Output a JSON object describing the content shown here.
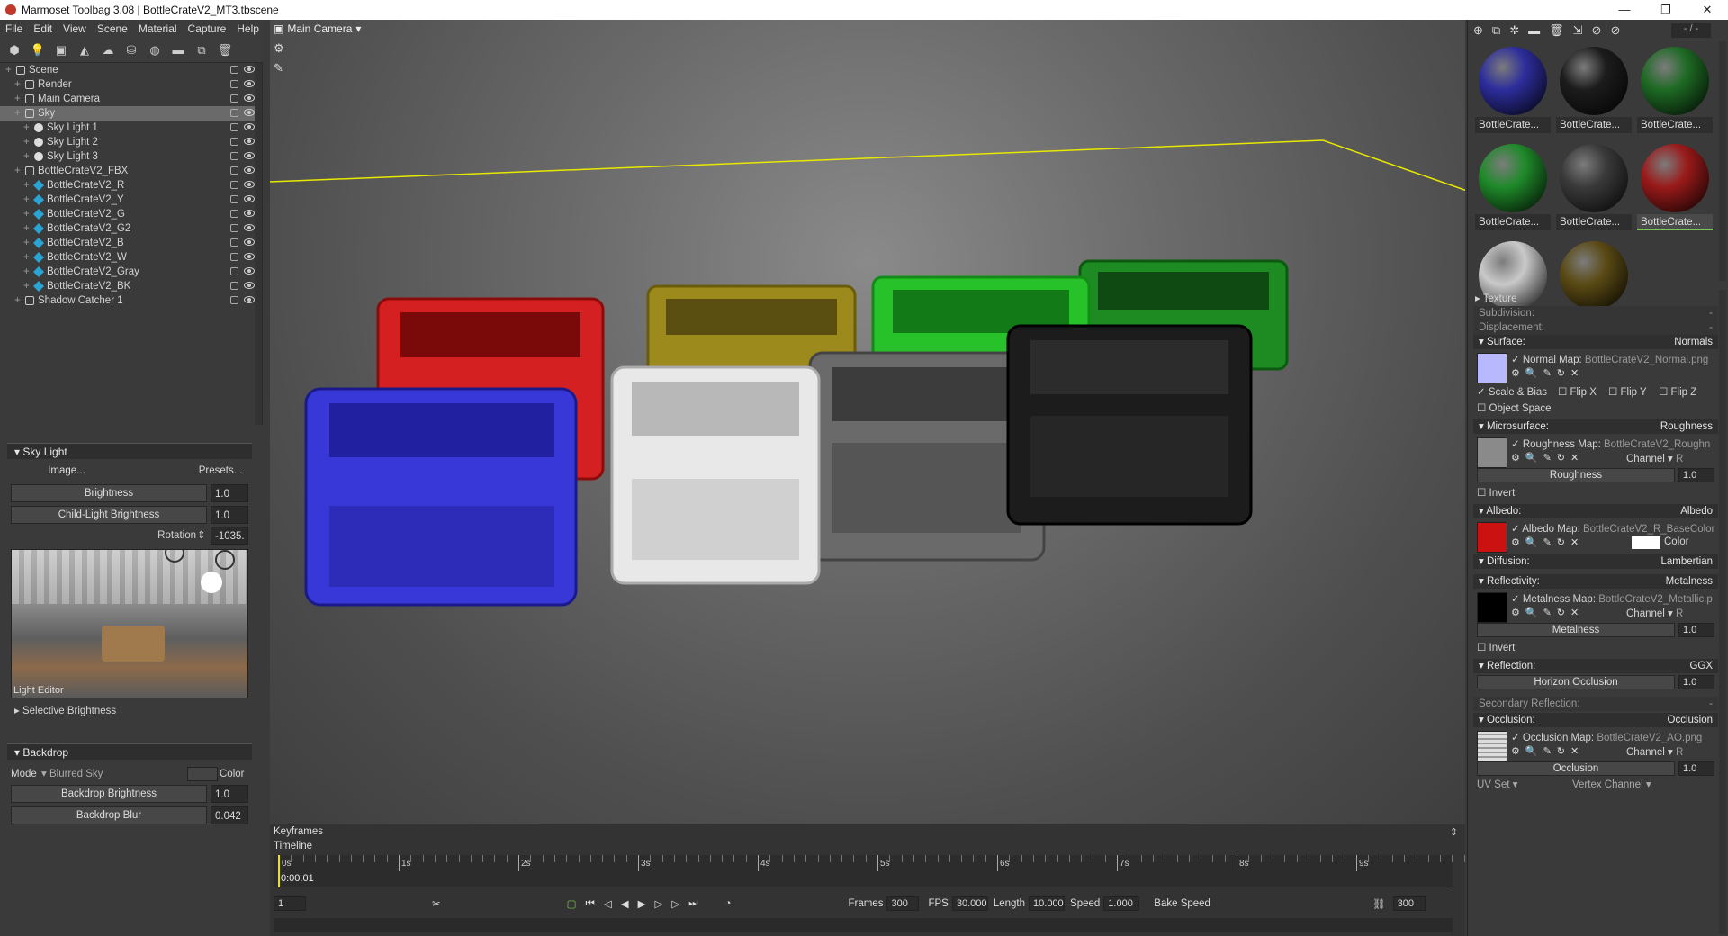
{
  "window": {
    "title": "Marmoset Toolbag 3.08  |  BottleCrateV2_MT3.tbscene",
    "minimize": "—",
    "restore": "❐",
    "close": "✕"
  },
  "menu": [
    "File",
    "Edit",
    "View",
    "Scene",
    "Material",
    "Capture",
    "Help"
  ],
  "viewport": {
    "camera_label": "Main Camera"
  },
  "outliner": {
    "items": [
      {
        "label": "Scene",
        "depth": 0,
        "icon": "scene-icon"
      },
      {
        "label": "Render",
        "depth": 1,
        "icon": "render-icon"
      },
      {
        "label": "Main Camera",
        "depth": 1,
        "icon": "camera-icon"
      },
      {
        "label": "Sky",
        "depth": 1,
        "icon": "sky-icon",
        "selected": true
      },
      {
        "label": "Sky Light 1",
        "depth": 2,
        "icon": "light-icon"
      },
      {
        "label": "Sky Light 2",
        "depth": 2,
        "icon": "light-icon"
      },
      {
        "label": "Sky Light 3",
        "depth": 2,
        "icon": "light-icon"
      },
      {
        "label": "BottleCrateV2_FBX",
        "depth": 1,
        "icon": "mesh-group-icon"
      },
      {
        "label": "BottleCrateV2_R",
        "depth": 2,
        "icon": "mesh-icon"
      },
      {
        "label": "BottleCrateV2_Y",
        "depth": 2,
        "icon": "mesh-icon"
      },
      {
        "label": "BottleCrateV2_G",
        "depth": 2,
        "icon": "mesh-icon"
      },
      {
        "label": "BottleCrateV2_G2",
        "depth": 2,
        "icon": "mesh-icon"
      },
      {
        "label": "BottleCrateV2_B",
        "depth": 2,
        "icon": "mesh-icon"
      },
      {
        "label": "BottleCrateV2_W",
        "depth": 2,
        "icon": "mesh-icon"
      },
      {
        "label": "BottleCrateV2_Gray",
        "depth": 2,
        "icon": "mesh-icon"
      },
      {
        "label": "BottleCrateV2_BK",
        "depth": 2,
        "icon": "mesh-icon"
      },
      {
        "label": "Shadow Catcher 1",
        "depth": 1,
        "icon": "shadow-catcher-icon"
      }
    ]
  },
  "skylight": {
    "header": "Sky Light",
    "image_btn": "Image...",
    "presets_btn": "Presets...",
    "brightness_label": "Brightness",
    "brightness": "1.0",
    "child_label": "Child-Light Brightness",
    "child": "1.0",
    "rotation_label": "Rotation",
    "rotation": "-1035.",
    "light_editor": "Light Editor",
    "selective": "Selective Brightness"
  },
  "backdrop": {
    "header": "Backdrop",
    "mode_label": "Mode",
    "mode_value": "Blurred Sky",
    "color_label": "Color",
    "brightness_label": "Backdrop Brightness",
    "brightness": "1.0",
    "blur_label": "Backdrop Blur",
    "blur": "0.042"
  },
  "timeline": {
    "keyframes": "Keyframes",
    "timeline": "Timeline",
    "current_time": "0:00.01",
    "ticks": [
      "0s",
      "1s",
      "2s",
      "3s",
      "4s",
      "5s",
      "6s",
      "7s",
      "8s",
      "9s"
    ],
    "frame_field": "1",
    "frames_label": "Frames",
    "frames": "300",
    "fps_label": "FPS",
    "fps": "30.000",
    "length_label": "Length",
    "length": "10.000",
    "speed_label": "Speed",
    "speed": "1.000",
    "bake_speed": "Bake Speed",
    "end_frame": "300"
  },
  "materials": {
    "swatches": [
      {
        "label": "BottleCrate...",
        "color": "#2d2d9c"
      },
      {
        "label": "BottleCrate...",
        "color": "#1c1c1c"
      },
      {
        "label": "BottleCrate...",
        "color": "#1e6a24"
      },
      {
        "label": "BottleCrate...",
        "color": "#1f8a2a"
      },
      {
        "label": "BottleCrate...",
        "color": "#3a3a3a"
      },
      {
        "label": "BottleCrate...",
        "color": "#9a1a1a",
        "selected": true
      },
      {
        "label": "BottleCrate...",
        "color": "#c9c9c9"
      },
      {
        "label": "BottleCrate...",
        "color": "#5a4a14"
      }
    ],
    "counter": "- / -"
  },
  "props": {
    "texture": "Texture",
    "subdivision": "Subdivision:",
    "subdivision_val": "-",
    "displacement": "Displacement:",
    "displacement_val": "-",
    "surface": "Surface:",
    "surface_val": "Normals",
    "normal_map": "Normal Map:",
    "normal_file": "BottleCrateV2_Normal.png",
    "scale_bias": "Scale & Bias",
    "flip_x": "Flip X",
    "flip_y": "Flip Y",
    "flip_z": "Flip Z",
    "object_space": "Object Space",
    "microsurface": "Microsurface:",
    "microsurface_val": "Roughness",
    "roughness_map": "Roughness Map:",
    "roughness_file": "BottleCrateV2_Roughn",
    "channel": "Channel",
    "channel_val": "R",
    "roughness": "Roughness",
    "roughness_num": "1.0",
    "invert": "Invert",
    "albedo": "Albedo:",
    "albedo_val": "Albedo",
    "albedo_map": "Albedo Map:",
    "albedo_file": "BottleCrateV2_R_BaseColor",
    "color": "Color",
    "diffusion": "Diffusion:",
    "diffusion_val": "Lambertian",
    "reflectivity": "Reflectivity:",
    "reflectivity_val": "Metalness",
    "metalness_map": "Metalness Map:",
    "metalness_file": "BottleCrateV2_Metallic.p",
    "metalness": "Metalness",
    "metalness_num": "1.0",
    "reflection": "Reflection:",
    "reflection_val": "GGX",
    "horizon": "Horizon Occlusion",
    "horizon_num": "1.0",
    "secondary": "Secondary Reflection:",
    "secondary_val": "-",
    "occlusion": "Occlusion:",
    "occlusion_val": "Occlusion",
    "occlusion_map": "Occlusion Map:",
    "occlusion_file": "BottleCrateV2_AO.png",
    "occlusion_label": "Occlusion",
    "occlusion_num": "1.0",
    "uv_set": "UV Set",
    "vertex_channel": "Vertex Channel"
  },
  "colors": {
    "accent_red": "#cc1111",
    "normal_blue": "#b8b8ff",
    "crate_red": "#d42020",
    "crate_blue": "#3838d8",
    "crate_yellow": "#9c8a1c",
    "crate_green": "#22b822",
    "crate_white": "#e8e8e8",
    "crate_gray": "#6a6a6a",
    "crate_black": "#1c1c1c"
  }
}
